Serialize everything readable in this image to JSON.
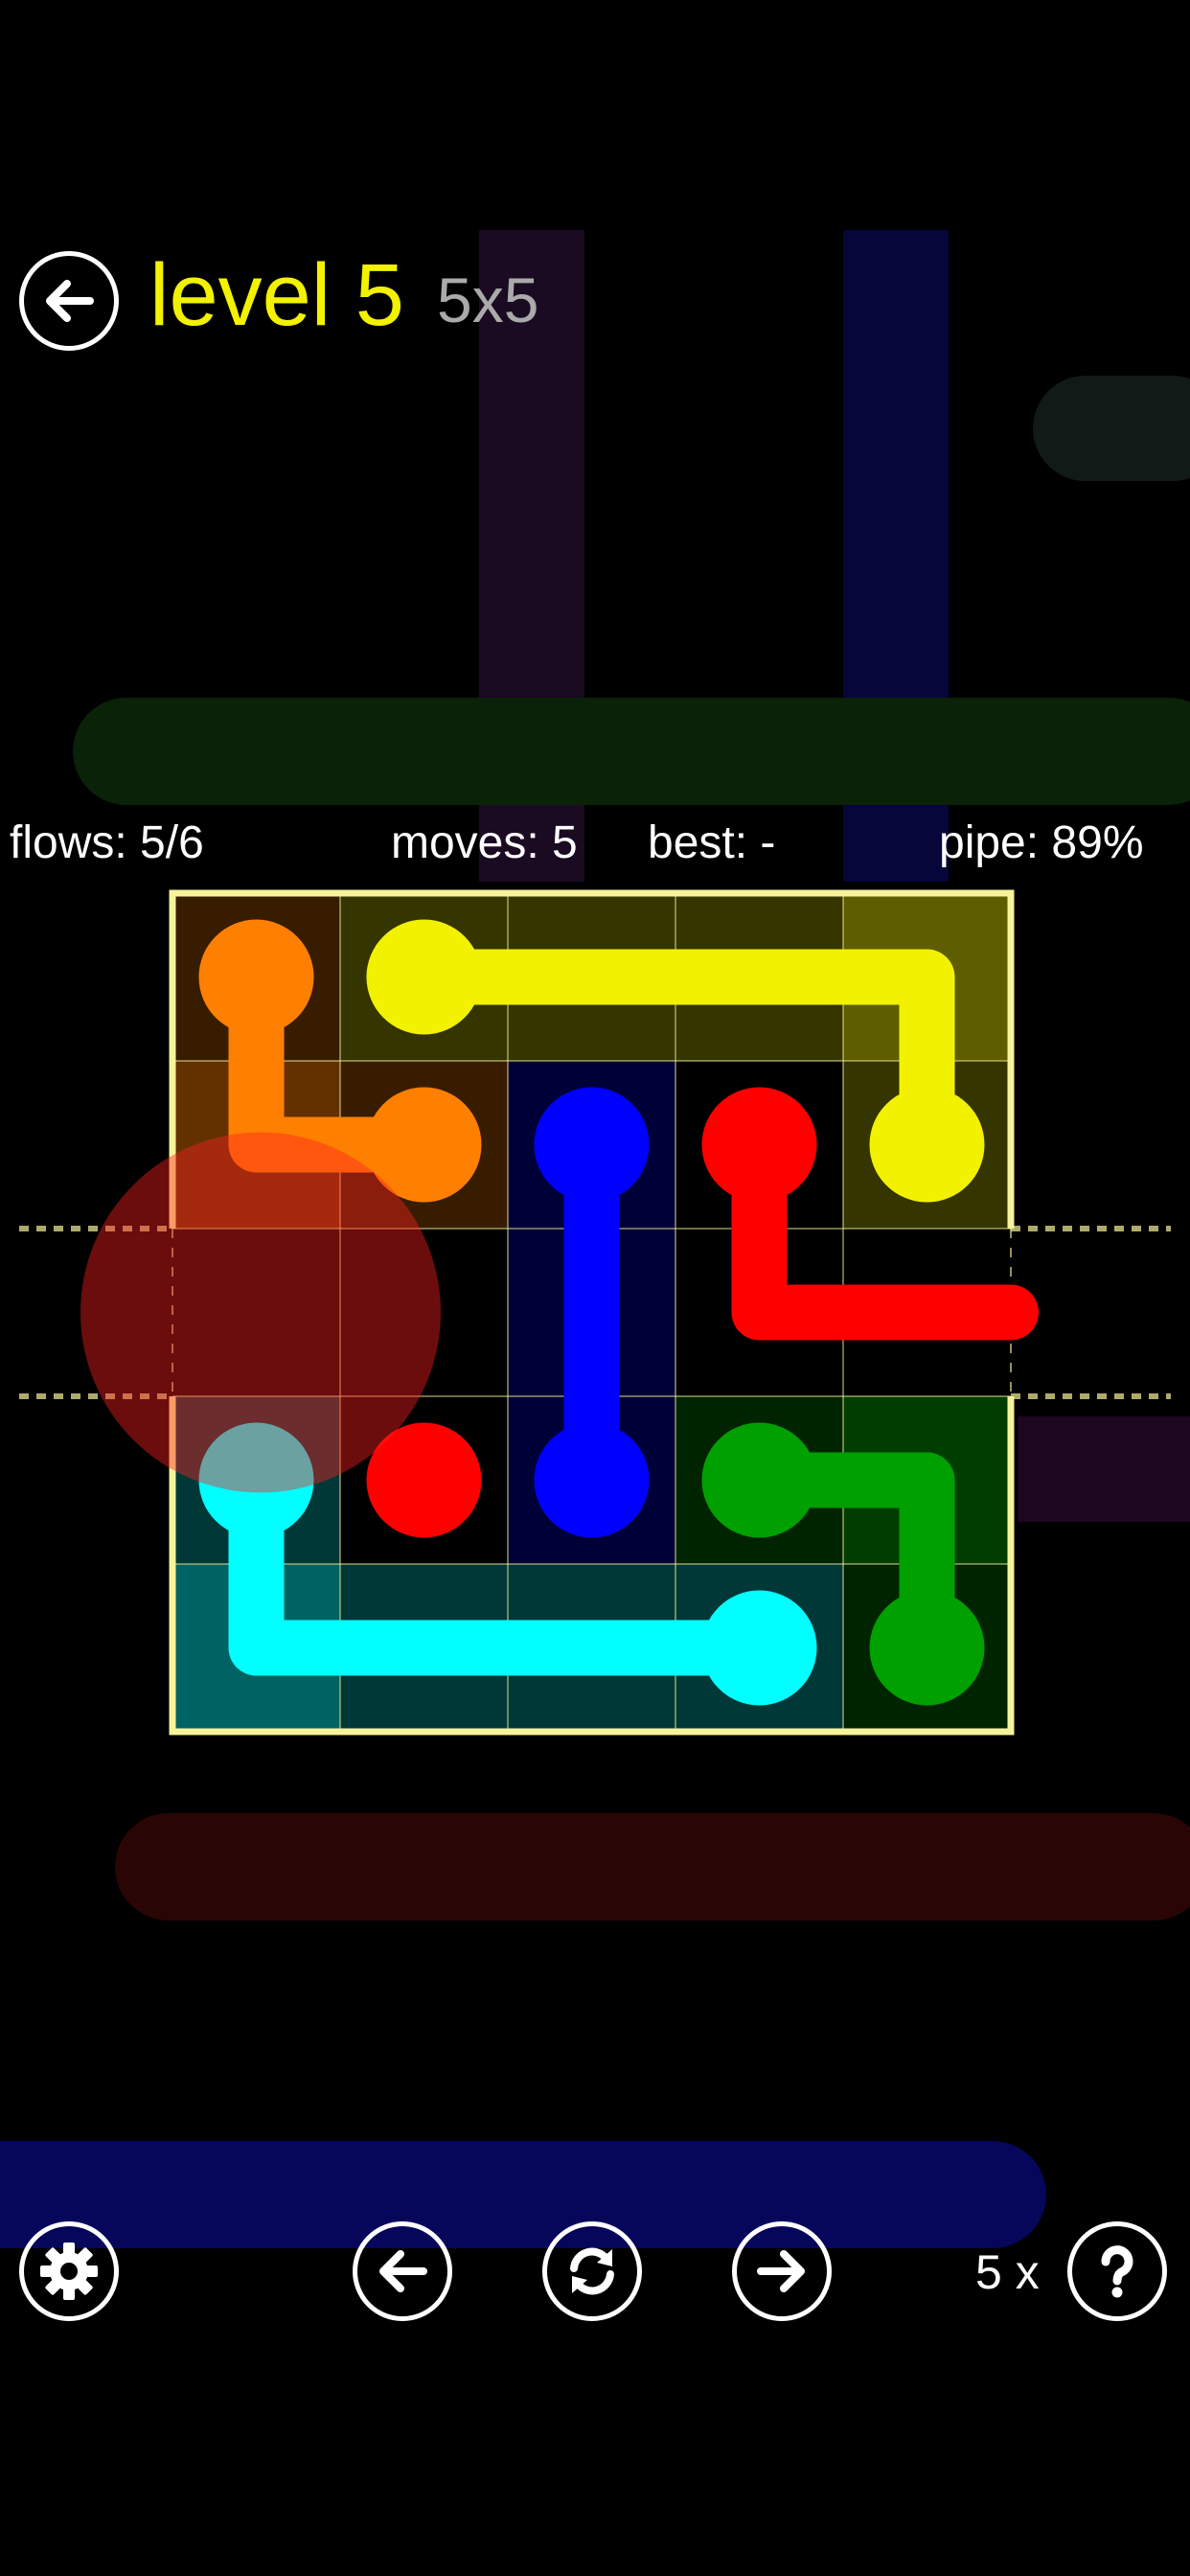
{
  "header": {
    "level_label": "level 5",
    "size_label": "5x5",
    "level_color": "#F2F200",
    "size_color": "#AAAAAA"
  },
  "stats": {
    "flows": "flows: 5/6",
    "moves": "moves: 5",
    "best": "best: -",
    "pipe": "pipe: 89%"
  },
  "footer": {
    "hint_count": "5 x"
  },
  "icons": {
    "back": "arrow-left-icon",
    "settings": "gear-icon",
    "previous": "arrow-left-icon",
    "restart": "refresh-icon",
    "next": "arrow-right-icon",
    "hint": "question-mark-icon"
  },
  "board": {
    "cols": 5,
    "rows": 5,
    "border_color": "#F6F39A",
    "bridge_row": 2,
    "flows": [
      {
        "name": "orange",
        "color": "#FF8000",
        "path": [
          [
            0,
            0
          ],
          [
            1,
            0
          ],
          [
            1,
            1
          ]
        ],
        "complete": true
      },
      {
        "name": "yellow",
        "color": "#F2F200",
        "path": [
          [
            0,
            1
          ],
          [
            0,
            4
          ],
          [
            1,
            4
          ]
        ],
        "complete": true
      },
      {
        "name": "blue",
        "color": "#0000FF",
        "path": [
          [
            1,
            2
          ],
          [
            3,
            2
          ]
        ],
        "complete": true
      },
      {
        "name": "red",
        "color": "#FF0000",
        "endpoints": [
          [
            1,
            3
          ],
          [
            3,
            1
          ]
        ],
        "path": [
          [
            1,
            3
          ],
          [
            2,
            3
          ],
          [
            2,
            4
          ],
          [
            2,
            5
          ]
        ],
        "complete": false
      },
      {
        "name": "green",
        "color": "#00A000",
        "path": [
          [
            3,
            3
          ],
          [
            3,
            4
          ],
          [
            4,
            4
          ]
        ],
        "complete": true
      },
      {
        "name": "cyan",
        "color": "#00FFFF",
        "path": [
          [
            3,
            0
          ],
          [
            4,
            0
          ],
          [
            4,
            3
          ]
        ],
        "complete": true
      }
    ]
  },
  "colors": {
    "background": "#000000",
    "text": "#FFFFFF"
  }
}
